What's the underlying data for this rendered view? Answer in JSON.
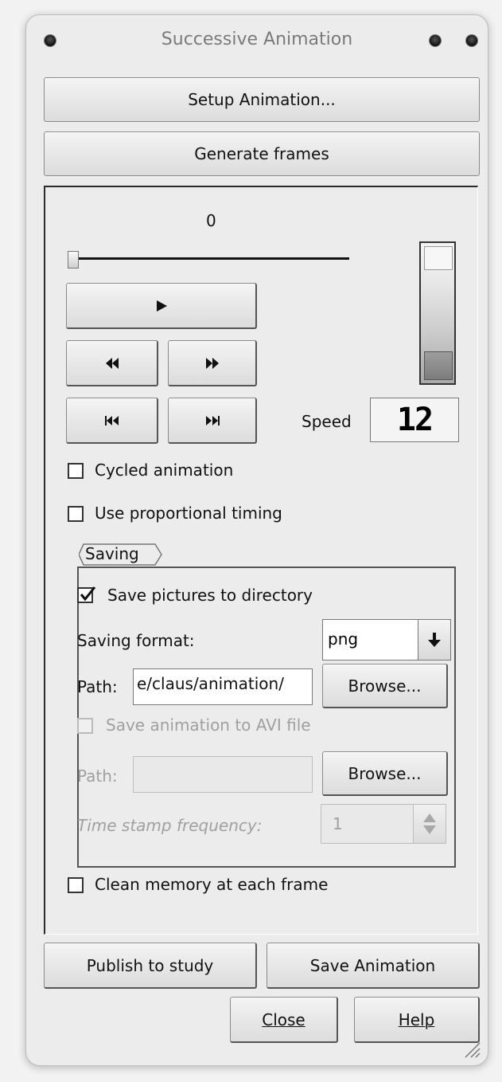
{
  "window": {
    "title": "Successive Animation"
  },
  "buttons": {
    "setup": "Setup Animation...",
    "generate": "Generate frames",
    "publish": "Publish to study",
    "save_animation": "Save Animation",
    "close": "Close",
    "help": "Help"
  },
  "player": {
    "frame_value": "0",
    "slider_position": 0,
    "play_icon": "play-icon",
    "rewind_icon": "rewind-icon",
    "fast_forward_icon": "fast-forward-icon",
    "skip_first_icon": "skip-to-first-icon",
    "skip_last_icon": "skip-to-last-icon"
  },
  "speed": {
    "label": "Speed",
    "value": "12"
  },
  "options": {
    "cycled": {
      "label": "Cycled animation",
      "checked": false
    },
    "proportional": {
      "label": "Use proportional timing",
      "checked": false
    },
    "clean_memory": {
      "label": "Clean memory at each frame",
      "checked": false
    }
  },
  "saving": {
    "group_label": "Saving",
    "save_pictures": {
      "label": "Save pictures to directory",
      "checked": true
    },
    "format_label": "Saving format:",
    "format_value": "png",
    "path_label": "Path:",
    "path_value": "e/claus/animation/",
    "browse": "Browse...",
    "save_avi": {
      "label": "Save animation to AVI file",
      "checked": false,
      "enabled": false
    },
    "avi_path_label": "Path:",
    "avi_path_value": "",
    "avi_browse": "Browse...",
    "timestamp_label": "Time stamp frequency:",
    "timestamp_value": "1"
  }
}
